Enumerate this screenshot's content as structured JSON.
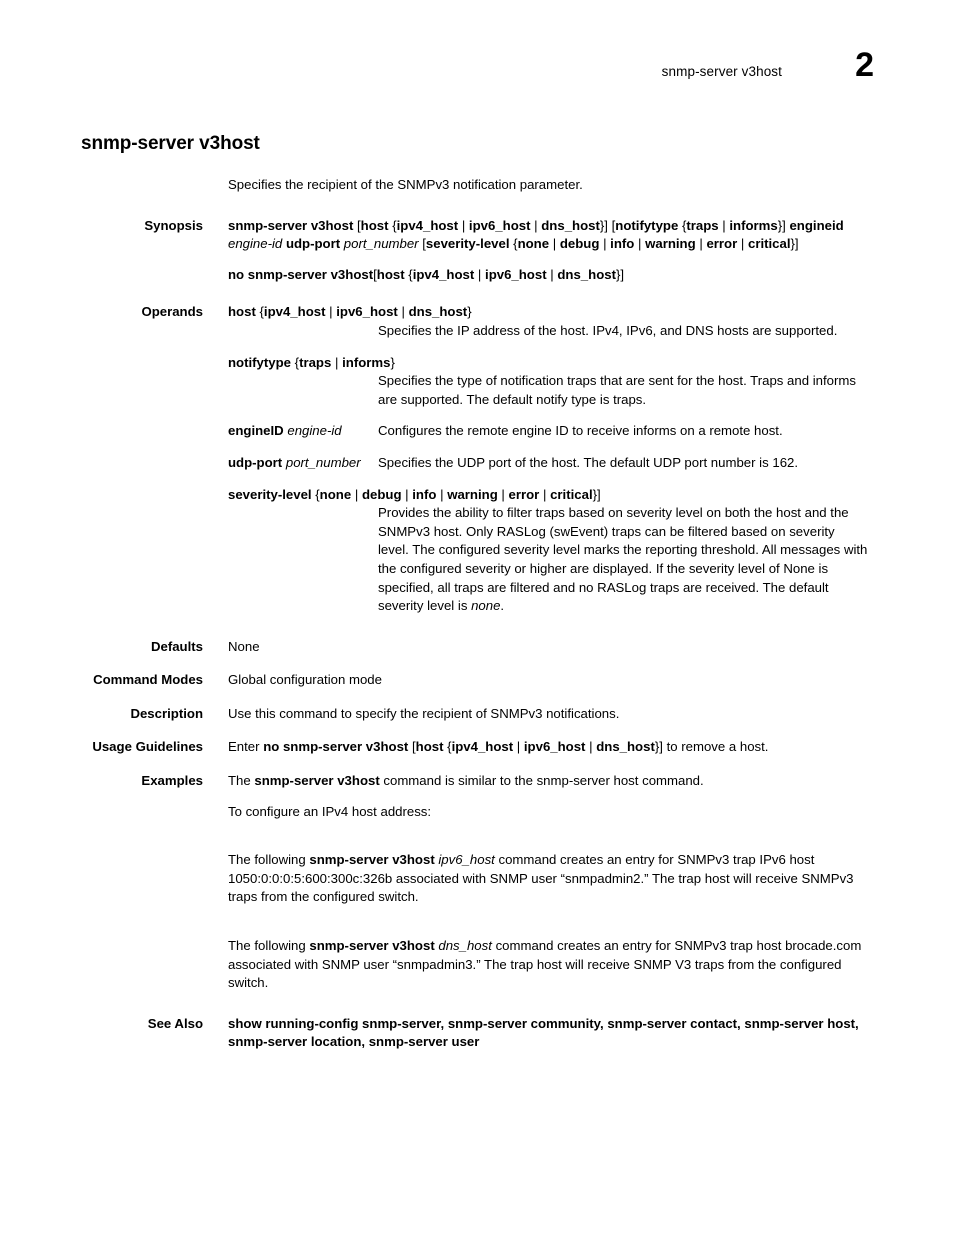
{
  "header": {
    "title": "snmp-server v3host",
    "page_number": "2"
  },
  "command": {
    "title": "snmp-server v3host",
    "intro": "Specifies the recipient of the SNMPv3 notification parameter."
  },
  "labels": {
    "synopsis": "Synopsis",
    "operands": "Operands",
    "defaults": "Defaults",
    "command_modes": "Command Modes",
    "description": "Description",
    "usage_guidelines": "Usage Guidelines",
    "examples": "Examples",
    "see_also": "See Also"
  },
  "synopsis": {
    "line1": [
      {
        "t": "snmp-server v3host ",
        "s": "b"
      },
      {
        "t": "[",
        "s": "n"
      },
      {
        "t": "host ",
        "s": "b"
      },
      {
        "t": "{",
        "s": "n"
      },
      {
        "t": "ipv4_host",
        "s": "b"
      },
      {
        "t": " | ",
        "s": "n"
      },
      {
        "t": "ipv6_host",
        "s": "b"
      },
      {
        "t": " | ",
        "s": "n"
      },
      {
        "t": "dns_host",
        "s": "b"
      },
      {
        "t": "}] [",
        "s": "n"
      },
      {
        "t": "notifytype ",
        "s": "b"
      },
      {
        "t": "{",
        "s": "n"
      },
      {
        "t": "traps",
        "s": "b"
      },
      {
        "t": " | ",
        "s": "n"
      },
      {
        "t": "informs",
        "s": "b"
      },
      {
        "t": "}] ",
        "s": "n"
      },
      {
        "t": "engineid ",
        "s": "b"
      },
      {
        "t": "engine-id",
        "s": "i"
      },
      {
        "t": " ",
        "s": "n"
      },
      {
        "t": "udp-port ",
        "s": "b"
      },
      {
        "t": "port_number",
        "s": "i"
      },
      {
        "t": " [",
        "s": "n"
      },
      {
        "t": "severity-level ",
        "s": "b"
      },
      {
        "t": "{",
        "s": "n"
      },
      {
        "t": "none",
        "s": "b"
      },
      {
        "t": " | ",
        "s": "n"
      },
      {
        "t": "debug",
        "s": "b"
      },
      {
        "t": " | ",
        "s": "n"
      },
      {
        "t": "info",
        "s": "b"
      },
      {
        "t": " | ",
        "s": "n"
      },
      {
        "t": "warning",
        "s": "b"
      },
      {
        "t": " | ",
        "s": "n"
      },
      {
        "t": "error",
        "s": "b"
      },
      {
        "t": " | ",
        "s": "n"
      },
      {
        "t": "critical",
        "s": "b"
      },
      {
        "t": "}]",
        "s": "n"
      }
    ],
    "line2": [
      {
        "t": "no snmp-server v3host",
        "s": "b"
      },
      {
        "t": "[",
        "s": "n"
      },
      {
        "t": "host ",
        "s": "b"
      },
      {
        "t": "{",
        "s": "n"
      },
      {
        "t": "ipv4_host",
        "s": "b"
      },
      {
        "t": " | ",
        "s": "n"
      },
      {
        "t": "ipv6_host",
        "s": "b"
      },
      {
        "t": " | ",
        "s": "n"
      },
      {
        "t": "dns_host",
        "s": "b"
      },
      {
        "t": "}]",
        "s": "n"
      }
    ]
  },
  "operands": [
    {
      "layout": "stacked",
      "term": [
        {
          "t": "host ",
          "s": "b"
        },
        {
          "t": "{",
          "s": "n"
        },
        {
          "t": "ipv4_host",
          "s": "b"
        },
        {
          "t": " | ",
          "s": "n"
        },
        {
          "t": "ipv6_host",
          "s": "b"
        },
        {
          "t": " | ",
          "s": "n"
        },
        {
          "t": "dns_host",
          "s": "b"
        },
        {
          "t": "}",
          "s": "n"
        }
      ],
      "desc": [
        {
          "t": "Specifies the IP address of the host. IPv4, IPv6, and DNS hosts are supported.",
          "s": "n"
        }
      ]
    },
    {
      "layout": "stacked",
      "term": [
        {
          "t": "notifytype ",
          "s": "b"
        },
        {
          "t": "{",
          "s": "n"
        },
        {
          "t": "traps",
          "s": "b"
        },
        {
          "t": " | ",
          "s": "n"
        },
        {
          "t": "informs",
          "s": "b"
        },
        {
          "t": "}",
          "s": "n"
        }
      ],
      "desc": [
        {
          "t": "Specifies the type of notification traps that are sent for the host. Traps and informs are supported. The default notify type is traps.",
          "s": "n"
        }
      ]
    },
    {
      "layout": "inline",
      "term": [
        {
          "t": "engineID ",
          "s": "b"
        },
        {
          "t": "engine-id",
          "s": "i"
        }
      ],
      "desc": [
        {
          "t": "Configures the remote engine ID to receive informs on a remote host.",
          "s": "n"
        }
      ]
    },
    {
      "layout": "inline",
      "term": [
        {
          "t": "udp-port ",
          "s": "b"
        },
        {
          "t": "port_number",
          "s": "i"
        }
      ],
      "desc": [
        {
          "t": "Specifies the UDP port of the host. The default UDP port number is 162.",
          "s": "n"
        }
      ]
    },
    {
      "layout": "stacked",
      "term": [
        {
          "t": "severity-level ",
          "s": "b"
        },
        {
          "t": "{",
          "s": "n"
        },
        {
          "t": "none",
          "s": "b"
        },
        {
          "t": " | ",
          "s": "n"
        },
        {
          "t": "debug",
          "s": "b"
        },
        {
          "t": " | ",
          "s": "n"
        },
        {
          "t": "info",
          "s": "b"
        },
        {
          "t": " | ",
          "s": "n"
        },
        {
          "t": "warning",
          "s": "b"
        },
        {
          "t": " | ",
          "s": "n"
        },
        {
          "t": "error",
          "s": "b"
        },
        {
          "t": " | ",
          "s": "n"
        },
        {
          "t": "critical",
          "s": "b"
        },
        {
          "t": "}]",
          "s": "n"
        }
      ],
      "desc": [
        {
          "t": "Provides the ability to filter traps based on severity level on both the host and the SNMPv3 host. Only RASLog (swEvent) traps can be filtered based on severity level. The configured severity level marks the reporting threshold. All messages with the configured severity or higher are displayed. If the severity level of None is specified, all traps are filtered and no RASLog traps are received. The default severity level is ",
          "s": "n"
        },
        {
          "t": "none",
          "s": "i"
        },
        {
          "t": ".",
          "s": "n"
        }
      ]
    }
  ],
  "defaults": {
    "text": "None"
  },
  "command_modes": {
    "text": "Global configuration mode"
  },
  "description": {
    "text": "Use this command to specify the recipient of SNMPv3 notifications."
  },
  "usage_guidelines": {
    "line": [
      {
        "t": "Enter ",
        "s": "n"
      },
      {
        "t": "no snmp-server v3host ",
        "s": "b"
      },
      {
        "t": "[",
        "s": "n"
      },
      {
        "t": "host ",
        "s": "b"
      },
      {
        "t": "{",
        "s": "n"
      },
      {
        "t": "ipv4_host",
        "s": "b"
      },
      {
        "t": " | ",
        "s": "n"
      },
      {
        "t": "ipv6_host",
        "s": "b"
      },
      {
        "t": " | ",
        "s": "n"
      },
      {
        "t": "dns_host",
        "s": "b"
      },
      {
        "t": "}] to remove a host.",
        "s": "n"
      }
    ]
  },
  "examples": {
    "para1": [
      {
        "t": "The ",
        "s": "n"
      },
      {
        "t": "snmp-server v3host",
        "s": "b"
      },
      {
        "t": " command is similar to the snmp-server host command.",
        "s": "n"
      }
    ],
    "para2": [
      {
        "t": "To configure an IPv4 host address:",
        "s": "n"
      }
    ],
    "para3": [
      {
        "t": "The following ",
        "s": "n"
      },
      {
        "t": "snmp-server v3host ",
        "s": "b"
      },
      {
        "t": "ipv6_host",
        "s": "i"
      },
      {
        "t": " command creates an entry for SNMPv3 trap IPv6 host 1050:0:0:0:5:600:300c:326b associated with SNMP user “snmpadmin2.” The trap host will receive SNMPv3 traps from the configured switch.",
        "s": "n"
      }
    ],
    "para4": [
      {
        "t": "The following ",
        "s": "n"
      },
      {
        "t": "snmp-server v3host ",
        "s": "b"
      },
      {
        "t": "dns_host",
        "s": "i"
      },
      {
        "t": " command creates an entry for SNMPv3 trap host brocade.com associated with SNMP user “snmpadmin3.” The trap host will receive SNMP V3 traps from the configured switch.",
        "s": "n"
      }
    ]
  },
  "see_also": {
    "line": [
      {
        "t": "show running-config snmp-server, snmp-server community, snmp-server contact, snmp-server host, snmp-server location, snmp-server user",
        "s": "b"
      }
    ]
  }
}
